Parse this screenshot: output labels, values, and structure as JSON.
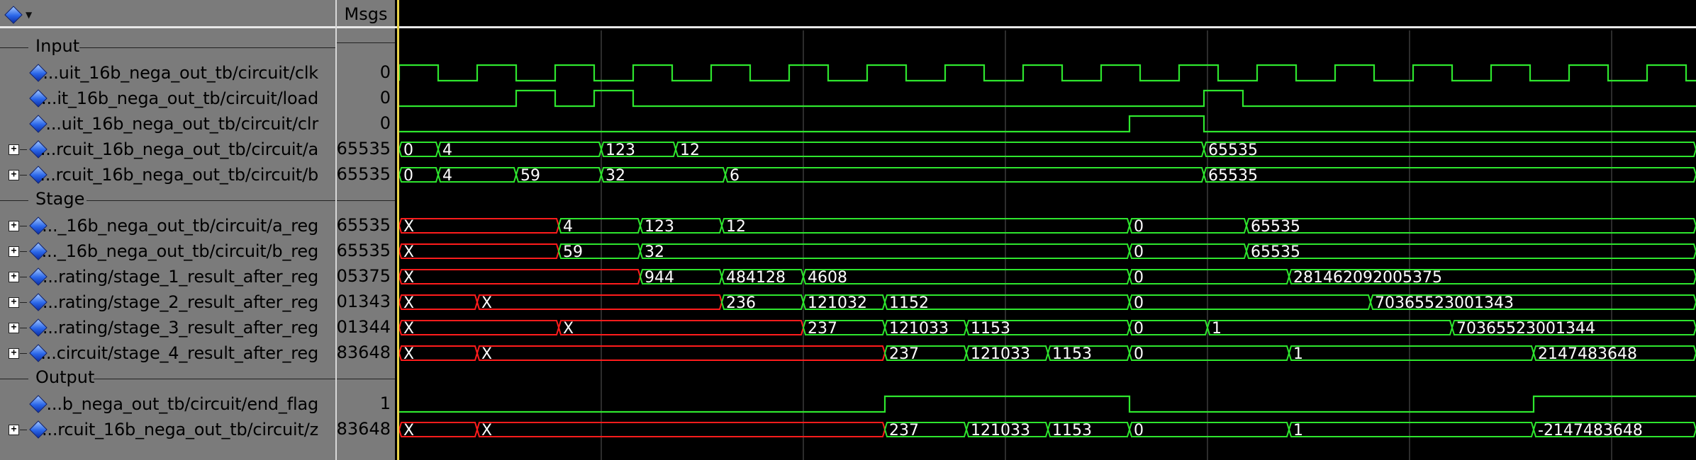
{
  "header": {
    "msgs_label": "Msgs"
  },
  "groups": [
    {
      "label": "Input"
    },
    {
      "label": "Stage"
    },
    {
      "label": "Output"
    }
  ],
  "signals": [
    {
      "name": "...uit_16b_nega_out_tb/circuit/clk",
      "value": "0",
      "expandable": false
    },
    {
      "name": "...it_16b_nega_out_tb/circuit/load",
      "value": "0",
      "expandable": false
    },
    {
      "name": "...uit_16b_nega_out_tb/circuit/clr",
      "value": "0",
      "expandable": false
    },
    {
      "name": "...rcuit_16b_nega_out_tb/circuit/a",
      "value": "65535",
      "expandable": true
    },
    {
      "name": "...rcuit_16b_nega_out_tb/circuit/b",
      "value": "65535",
      "expandable": true
    },
    {
      "name": "..._16b_nega_out_tb/circuit/a_reg",
      "value": "65535",
      "expandable": true
    },
    {
      "name": "..._16b_nega_out_tb/circuit/b_reg",
      "value": "65535",
      "expandable": true
    },
    {
      "name": "...rating/stage_1_result_after_reg",
      "value": "05375",
      "expandable": true
    },
    {
      "name": "...rating/stage_2_result_after_reg",
      "value": "01343",
      "expandable": true
    },
    {
      "name": "...rating/stage_3_result_after_reg",
      "value": "01344",
      "expandable": true
    },
    {
      "name": "...circuit/stage_4_result_after_reg",
      "value": "83648",
      "expandable": true
    },
    {
      "name": "...b_nega_out_tb/circuit/end_flag",
      "value": "1",
      "expandable": false
    },
    {
      "name": "...rcuit_16b_nega_out_tb/circuit/z",
      "value": "83648",
      "expandable": true
    }
  ],
  "waves": {
    "clk": {
      "type": "bit",
      "edges": [
        0,
        55,
        110,
        165,
        220,
        275,
        330,
        385,
        440,
        495,
        550,
        605,
        660,
        715,
        770,
        825,
        880,
        935,
        990,
        1045,
        1100,
        1155,
        1210,
        1265,
        1320,
        1375,
        1430,
        1485,
        1540,
        1595,
        1650,
        1705,
        1760,
        1815
      ],
      "start": 0
    },
    "load": {
      "type": "bit",
      "edges": [
        165,
        220,
        275,
        330,
        1135,
        1190
      ],
      "start": 0
    },
    "clr": {
      "type": "bit",
      "edges": [
        1030,
        1135
      ],
      "start": 0
    },
    "a": {
      "type": "bus",
      "segments": [
        [
          "0",
          0,
          "g"
        ],
        [
          "4",
          55,
          "g"
        ],
        [
          "123",
          285,
          "g"
        ],
        [
          "12",
          390,
          "g"
        ],
        [
          "65535",
          1135,
          "g"
        ]
      ]
    },
    "b": {
      "type": "bus",
      "segments": [
        [
          "0",
          0,
          "g"
        ],
        [
          "4",
          55,
          "g"
        ],
        [
          "59",
          165,
          "g"
        ],
        [
          "32",
          285,
          "g"
        ],
        [
          "6",
          460,
          "g"
        ],
        [
          "65535",
          1135,
          "g"
        ]
      ]
    },
    "a_reg": {
      "type": "bus",
      "segments": [
        [
          "X",
          0,
          "r"
        ],
        [
          "4",
          225,
          "g"
        ],
        [
          "123",
          340,
          "g"
        ],
        [
          "12",
          455,
          "g"
        ],
        [
          "0",
          1030,
          "g"
        ],
        [
          "65535",
          1195,
          "g"
        ]
      ]
    },
    "b_reg": {
      "type": "bus",
      "segments": [
        [
          "X",
          0,
          "r"
        ],
        [
          "59",
          225,
          "g"
        ],
        [
          "32",
          340,
          "g"
        ],
        [
          "0",
          1030,
          "g"
        ],
        [
          "65535",
          1195,
          "g"
        ]
      ]
    },
    "stage1": {
      "type": "bus",
      "segments": [
        [
          "X",
          0,
          "r"
        ],
        [
          "944",
          340,
          "g"
        ],
        [
          "484128",
          455,
          "g"
        ],
        [
          "4608",
          570,
          "g"
        ],
        [
          "0",
          1030,
          "g"
        ],
        [
          "281462092005375",
          1255,
          "g"
        ]
      ]
    },
    "stage2": {
      "type": "bus",
      "segments": [
        [
          "X",
          0,
          "r"
        ],
        [
          "X",
          110,
          "r"
        ],
        [
          "236",
          455,
          "g"
        ],
        [
          "121032",
          570,
          "g"
        ],
        [
          "1152",
          685,
          "g"
        ],
        [
          "0",
          1030,
          "g"
        ],
        [
          "70365523001343",
          1370,
          "g"
        ]
      ]
    },
    "stage3": {
      "type": "bus",
      "segments": [
        [
          "X",
          0,
          "r"
        ],
        [
          "X",
          225,
          "r"
        ],
        [
          "237",
          570,
          "g"
        ],
        [
          "121033",
          685,
          "g"
        ],
        [
          "1153",
          800,
          "g"
        ],
        [
          "0",
          1030,
          "g"
        ],
        [
          "1",
          1140,
          "g"
        ],
        [
          "70365523001344",
          1485,
          "g"
        ]
      ]
    },
    "stage4": {
      "type": "bus",
      "segments": [
        [
          "X",
          0,
          "r"
        ],
        [
          "X",
          110,
          "r"
        ],
        [
          "237",
          685,
          "g"
        ],
        [
          "121033",
          800,
          "g"
        ],
        [
          "1153",
          915,
          "g"
        ],
        [
          "0",
          1030,
          "g"
        ],
        [
          "1",
          1255,
          "g"
        ],
        [
          "2147483648",
          1600,
          "g"
        ]
      ]
    },
    "end_flag": {
      "type": "bit",
      "edges": [
        685,
        1030,
        1600
      ],
      "start": 0
    },
    "z": {
      "type": "bus",
      "segments": [
        [
          "X",
          0,
          "r"
        ],
        [
          "X",
          110,
          "r"
        ],
        [
          "237",
          685,
          "g"
        ],
        [
          "121033",
          800,
          "g"
        ],
        [
          "1153",
          915,
          "g"
        ],
        [
          "0",
          1030,
          "g"
        ],
        [
          "1",
          1255,
          "g"
        ],
        [
          "-2147483648",
          1600,
          "g"
        ]
      ]
    }
  },
  "colors": {
    "wave_green": "#2ee62e",
    "wave_red": "#ff1c1c",
    "grid": "#3a3a3a",
    "cursor": "#e8d24a"
  }
}
